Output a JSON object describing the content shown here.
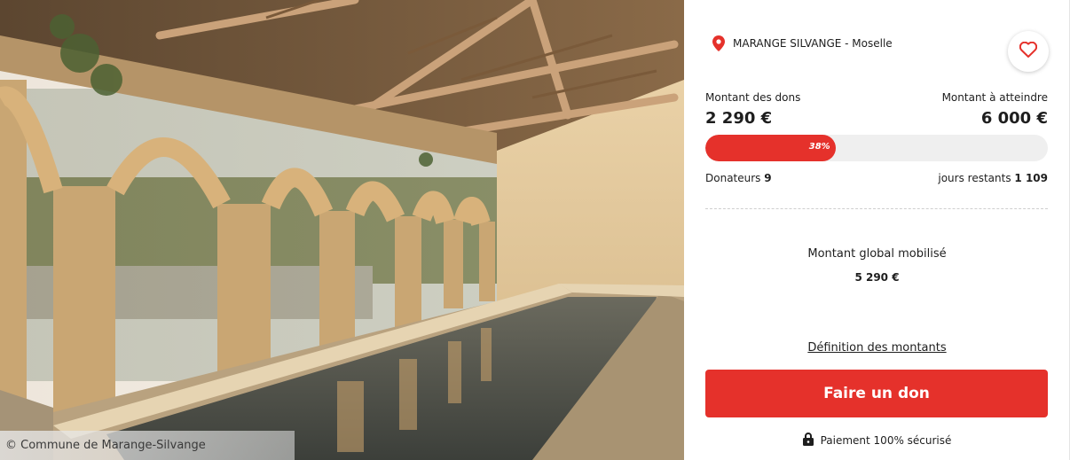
{
  "photo": {
    "credit": "© Commune de Marange-Silvange",
    "description_icon": "photo-lavoir"
  },
  "project": {
    "location": "MARANGE SILVANGE - Moselle",
    "location_icon": "map-pin-icon",
    "favorite_icon": "heart-icon"
  },
  "funding": {
    "raised_label": "Montant des dons",
    "raised_value": "2 290 €",
    "goal_label": "Montant à atteindre",
    "goal_value": "6 000 €",
    "progress_percent": 38,
    "progress_label": "38%",
    "donors_label": "Donateurs",
    "donors_value": "9",
    "days_label": "jours restants",
    "days_value": "1 109"
  },
  "global": {
    "label": "Montant global mobilisé",
    "value": "5 290 €"
  },
  "links": {
    "definition": "Définition des montants"
  },
  "cta": {
    "donate_label": "Faire un don"
  },
  "security": {
    "label": "Paiement 100% sécurisé",
    "icon": "lock-icon"
  },
  "colors": {
    "accent": "#e5312b",
    "text": "#1e1e1e",
    "track": "#efefef"
  }
}
